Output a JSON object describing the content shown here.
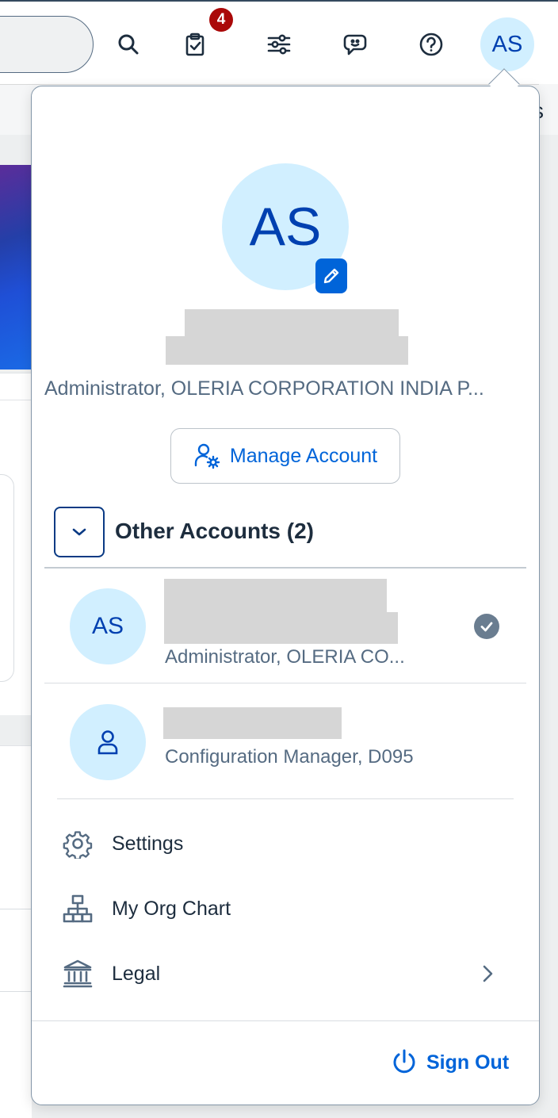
{
  "shell": {
    "notification_count": "4",
    "avatar_initials": "AS",
    "edge_text": "s",
    "icons": [
      "search-icon",
      "task-clipboard-icon",
      "settings-sliders-icon",
      "feedback-chat-icon",
      "help-icon"
    ]
  },
  "profile": {
    "avatar_initials": "AS",
    "role": "Administrator, OLERIA CORPORATION INDIA P...",
    "manage_label": "Manage Account"
  },
  "other_accounts": {
    "title": "Other Accounts (2)",
    "items": [
      {
        "initials": "AS",
        "role": "Administrator, OLERIA CO...",
        "active": true
      },
      {
        "initials": "",
        "icon": "person-icon",
        "role": "Configuration Manager, D095",
        "active": false
      }
    ]
  },
  "menu": {
    "items": [
      {
        "label": "Settings",
        "icon": "gear-icon"
      },
      {
        "label": "My Org Chart",
        "icon": "org-chart-icon"
      },
      {
        "label": "Legal",
        "icon": "legal-building-icon",
        "has_submenu": true
      }
    ]
  },
  "signout": {
    "label": "Sign Out"
  },
  "colors": {
    "accent": "#0064d9",
    "avatar_bg": "#d1efff",
    "avatar_text": "#0040b0",
    "badge": "#aa0808"
  }
}
